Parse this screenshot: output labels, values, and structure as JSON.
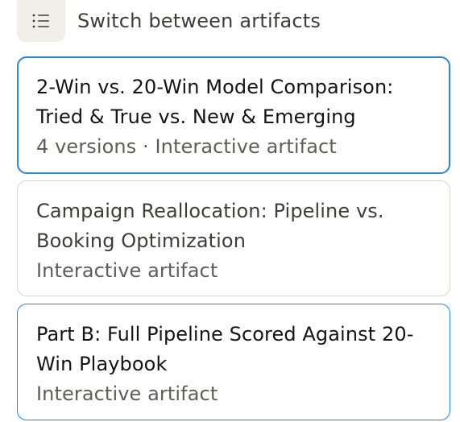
{
  "header": {
    "menu_icon": "list-icon",
    "title": "Switch between artifacts"
  },
  "artifacts": [
    {
      "title": "2-Win vs. 20-Win Model Comparison: Tried & True vs. New & Emerging",
      "meta": "4 versions · Interactive artifact",
      "selected": true
    },
    {
      "title": "Campaign Reallocation: Pipeline vs. Booking Optimization",
      "meta": "Interactive artifact",
      "selected": false
    },
    {
      "title": "Part B: Full Pipeline Scored Against 20-Win Playbook",
      "meta": "Interactive artifact",
      "selected": false
    }
  ],
  "colors": {
    "selected_border": "#2c84db",
    "card_border": "#d6d4cc",
    "menu_bg": "#f0efea"
  }
}
